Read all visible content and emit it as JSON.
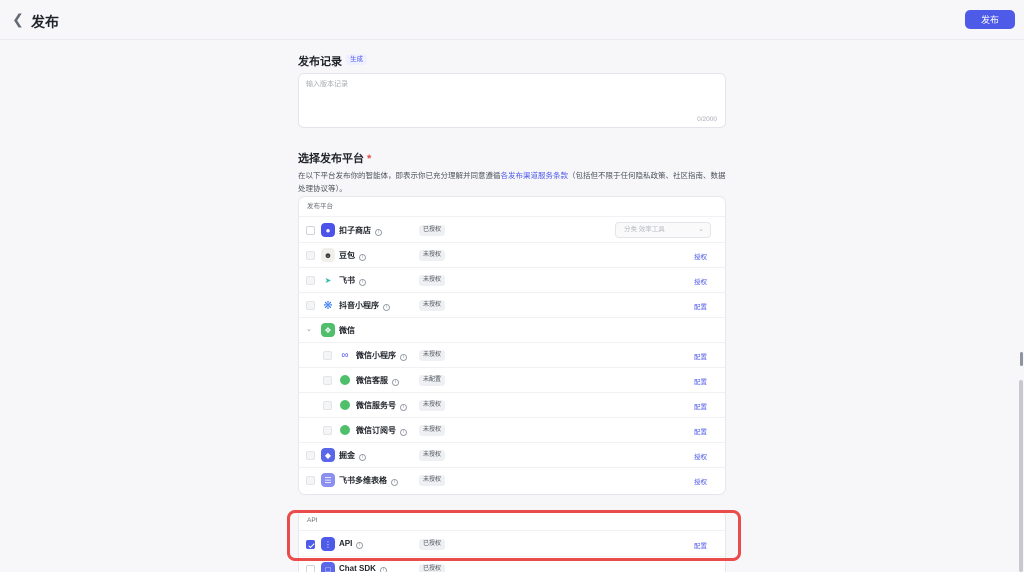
{
  "header": {
    "title": "发布",
    "publish_label": "发布"
  },
  "record": {
    "title": "发布记录",
    "generate_label": "生成",
    "placeholder": "输入版本记录",
    "counter": "0/2000"
  },
  "platform": {
    "title": "选择发布平台",
    "required_mark": "*",
    "desc_before": "在以下平台发布你的智能体，即表示你已充分理解并同意遵循",
    "desc_link": "各发布渠道服务条款",
    "desc_after": "（包括但不限于任何隐私政策、社区指南、数据处理协议等）。",
    "list_header": "发布平台",
    "category_placeholder": "分类  效率工具",
    "rows": [
      {
        "name": "扣子商店",
        "status": "已授权",
        "action": ""
      },
      {
        "name": "豆包",
        "status": "未授权",
        "action": "授权"
      },
      {
        "name": "飞书",
        "status": "未授权",
        "action": "授权"
      },
      {
        "name": "抖音小程序",
        "status": "未授权",
        "action": "配置"
      },
      {
        "name": "微信",
        "status": "",
        "action": ""
      },
      {
        "name": "微信小程序",
        "status": "未授权",
        "action": "配置"
      },
      {
        "name": "微信客服",
        "status": "未配置",
        "action": "配置"
      },
      {
        "name": "微信服务号",
        "status": "未授权",
        "action": "配置"
      },
      {
        "name": "微信订阅号",
        "status": "未授权",
        "action": "配置"
      },
      {
        "name": "掘金",
        "status": "未授权",
        "action": "授权"
      },
      {
        "name": "飞书多维表格",
        "status": "未授权",
        "action": "授权"
      }
    ]
  },
  "api": {
    "list_header": "API",
    "rows": [
      {
        "name": "API",
        "status": "已授权",
        "action": "配置"
      },
      {
        "name": "Chat SDK",
        "status": "已授权",
        "action": ""
      }
    ]
  },
  "colors": {
    "accent": "#4e5ae8",
    "highlight": "#ea4b4b"
  }
}
